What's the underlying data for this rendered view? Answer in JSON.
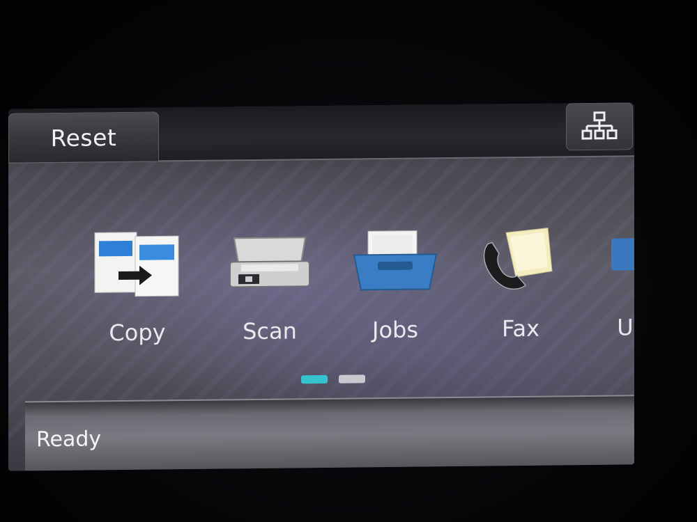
{
  "header": {
    "reset_label": "Reset",
    "network_icon": "network-tree-icon"
  },
  "apps": [
    {
      "label": "Copy",
      "icon": "copy-icon"
    },
    {
      "label": "Scan",
      "icon": "scanner-icon"
    },
    {
      "label": "Jobs",
      "icon": "jobs-tray-icon"
    },
    {
      "label": "Fax",
      "icon": "fax-phone-icon"
    },
    {
      "label": "U",
      "icon": "partial-app-icon"
    }
  ],
  "pager": {
    "pages": 2,
    "current": 1
  },
  "status": {
    "text": "Ready"
  },
  "colors": {
    "accent": "#35c4cf",
    "background": "#55545c",
    "text": "#e9e9ee"
  }
}
